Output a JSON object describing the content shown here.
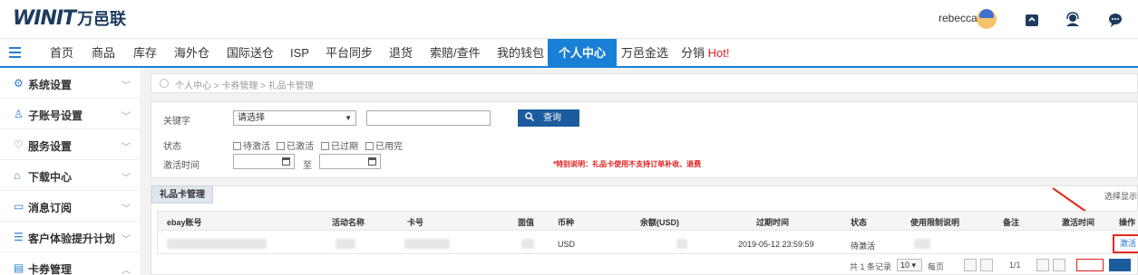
{
  "header": {
    "logo_mark": "WINIT",
    "logo_cn": "万邑联",
    "username": "rebecca"
  },
  "nav": {
    "items": [
      "首页",
      "商品",
      "库存",
      "海外仓",
      "国际送仓",
      "ISP",
      "平台同步",
      "退货",
      "索赔/查件",
      "我的钱包",
      "个人中心",
      "万邑金选",
      "分销"
    ],
    "hot_label": "Hot!",
    "active_index": 10
  },
  "sidebar": {
    "items": [
      {
        "label": "系统设置",
        "icon": "gear-icon"
      },
      {
        "label": "子账号设置",
        "icon": "user-icon"
      },
      {
        "label": "服务设置",
        "icon": "heart-icon"
      },
      {
        "label": "下载中心",
        "icon": "download-icon"
      },
      {
        "label": "消息订阅",
        "icon": "bookmark-icon"
      },
      {
        "label": "客户体验提升计划",
        "icon": "list-icon"
      },
      {
        "label": "卡券管理",
        "icon": "card-icon"
      }
    ]
  },
  "breadcrumb": "个人中心 > 卡券管理 > 礼品卡管理",
  "filter": {
    "keyword_label": "关键字",
    "select_value": "请选择",
    "search_label": "查询",
    "status_label": "状态",
    "statuses": [
      "待激活",
      "已激活",
      "已过期",
      "已用完"
    ],
    "activate_time_label": "激活时间",
    "to_label": "至",
    "notice": "*特别说明：礼品卡使用不支持订单补收、退费"
  },
  "panel": {
    "tab_label": "礼品卡管理",
    "choose_show": "选择显示列"
  },
  "table": {
    "columns": [
      "ebay账号",
      "活动名称",
      "卡号",
      "面值",
      "币种",
      "余额(USD)",
      "过期时间",
      "状态",
      "使用限制说明",
      "备注",
      "激活时间",
      "操作"
    ],
    "row": {
      "currency": "USD",
      "expire_time": "2019-05-12 23:59:59",
      "status": "待激活",
      "action": "激活"
    }
  },
  "pager": {
    "summary": "共 1 条记录",
    "page_size": "10",
    "per_page": "每页",
    "page_info": "1/1"
  },
  "colors": {
    "brand_blue": "#1a7fd6",
    "dark_blue_button": "#1c5c9e",
    "highlight_red": "#e12b1c"
  }
}
